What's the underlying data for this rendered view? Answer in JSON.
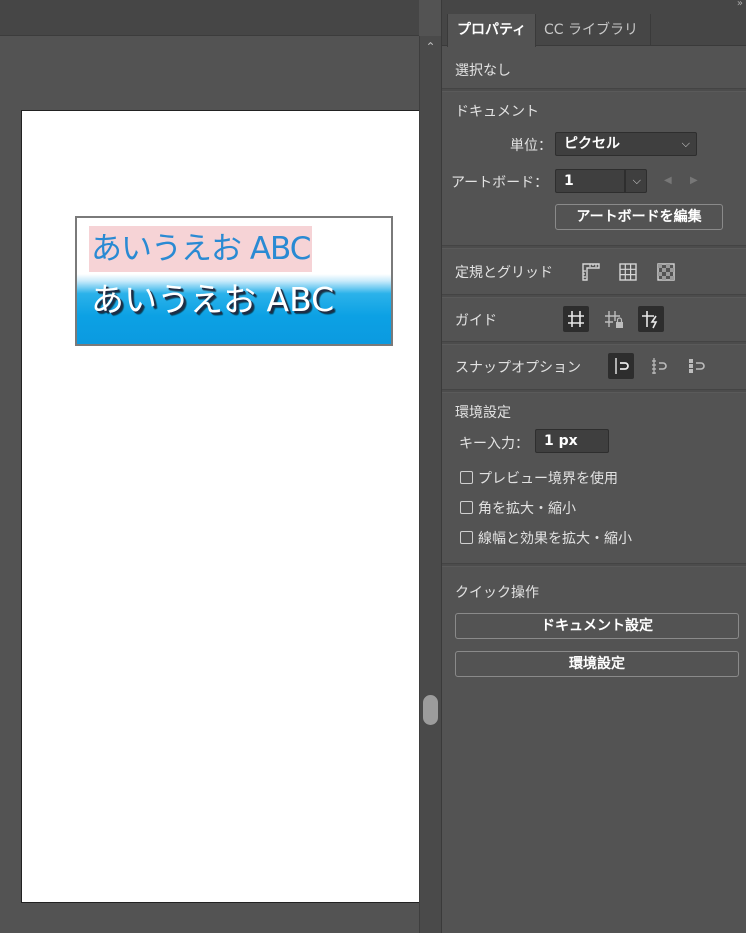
{
  "canvas": {
    "sample_text_1": "あいうえお ABC",
    "sample_text_2": "あいうえお ABC"
  },
  "scrollbar": {
    "up_glyph": "⌃"
  },
  "panel": {
    "collapse_glyph": "»",
    "tabs": [
      {
        "label": "プロパティ",
        "active": true
      },
      {
        "label": "CC ライブラリ",
        "active": false
      }
    ],
    "selection_status": "選択なし",
    "document": {
      "heading": "ドキュメント",
      "unit_label": "単位：",
      "unit_value": "ピクセル",
      "artboard_label": "アートボード：",
      "artboard_value": "1",
      "edit_artboard_button": "アートボードを編集"
    },
    "rulers_grids": {
      "heading": "定規とグリッド"
    },
    "guides": {
      "heading": "ガイド"
    },
    "snap_options": {
      "heading": "スナップオプション"
    },
    "preferences": {
      "heading": "環境設定",
      "key_increment_label": "キー入力：",
      "key_increment_value": "1 px",
      "checkboxes": [
        {
          "label": "プレビュー境界を使用",
          "checked": false
        },
        {
          "label": "角を拡大・縮小",
          "checked": false
        },
        {
          "label": "線幅と効果を拡大・縮小",
          "checked": false
        }
      ]
    },
    "quick_actions": {
      "heading": "クイック操作",
      "document_setup_button": "ドキュメント設定",
      "preferences_button": "環境設定"
    }
  },
  "colors": {
    "ui_background": "#535353",
    "sample_highlight": "#f6d3d6",
    "sample_text_blue": "#2a8ad3",
    "sample_bar_blue": "#0ca1e4"
  }
}
